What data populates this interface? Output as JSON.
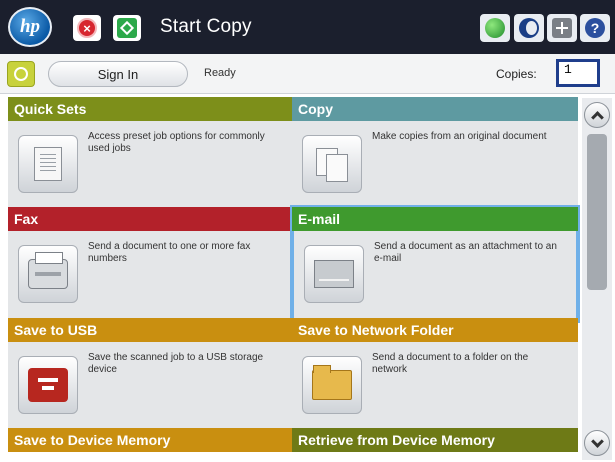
{
  "titlebar": {
    "logo_text": "hp",
    "title": "Start Copy",
    "icons": {
      "stop": "stop-icon",
      "start": "start-icon",
      "network": "network-icon",
      "sleep": "sleep-icon",
      "language": "language-icon",
      "help": "help-icon"
    },
    "help_glyph": "?"
  },
  "statusbar": {
    "home_icon": "home-icon",
    "sign_in_label": "Sign In",
    "status": "Ready",
    "copies_label": "Copies:",
    "copies_value": "1"
  },
  "tiles": [
    {
      "id": "quick-sets",
      "title": "Quick Sets",
      "description": "Access preset job options for commonly used jobs",
      "icon": "quick-sets-icon",
      "color": "#7d8f1a"
    },
    {
      "id": "copy",
      "title": "Copy",
      "description": "Make copies from an original document",
      "icon": "copy-icon",
      "color": "#5e9aa1"
    },
    {
      "id": "fax",
      "title": "Fax",
      "description": "Send a document to one or more fax numbers",
      "icon": "fax-icon",
      "color": "#b3212a"
    },
    {
      "id": "email",
      "title": "E-mail",
      "description": "Send a document as an attachment to an e-mail",
      "icon": "email-icon",
      "color": "#3f9a2e",
      "selected": true
    },
    {
      "id": "usb",
      "title": "Save to USB",
      "description": "Save the scanned job to a USB storage device",
      "icon": "usb-icon",
      "color": "#c98f10"
    },
    {
      "id": "network-folder",
      "title": "Save to Network Folder",
      "description": "Send a document to a folder on the network",
      "icon": "folder-icon",
      "color": "#c98f10"
    },
    {
      "id": "device-memory",
      "title": "Save to Device Memory",
      "color": "#c98f10"
    },
    {
      "id": "retrieve",
      "title": "Retrieve from Device Memory",
      "color": "#6e7a16"
    }
  ],
  "scrollbar": {
    "up_icon": "chevron-up-icon",
    "down_icon": "chevron-down-icon"
  }
}
